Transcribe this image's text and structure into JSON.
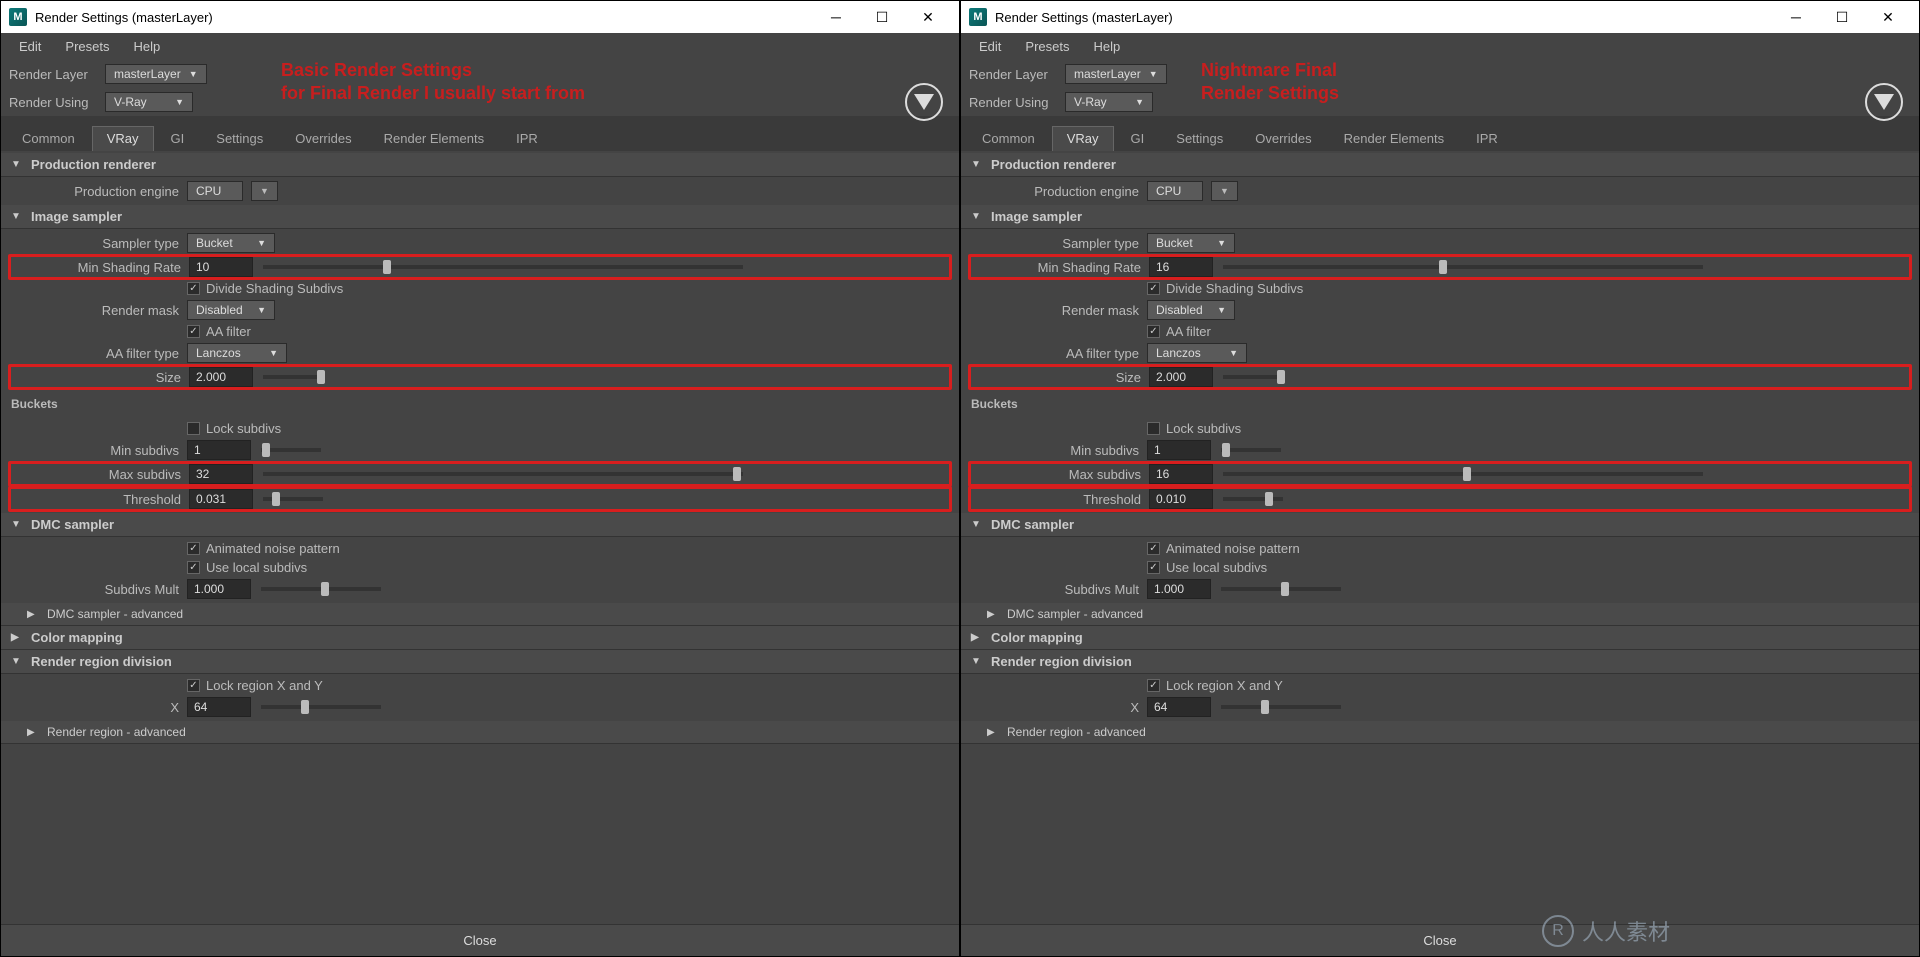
{
  "left": {
    "annotation": "Basic Render Settings\nfor Final Render I usually start from",
    "title": "Render Settings (masterLayer)",
    "menu": [
      "Edit",
      "Presets",
      "Help"
    ],
    "render_layer_label": "Render Layer",
    "render_layer_value": "masterLayer",
    "render_using_label": "Render Using",
    "render_using_value": "V-Ray",
    "tabs": [
      "Common",
      "VRay",
      "GI",
      "Settings",
      "Overrides",
      "Render Elements",
      "IPR"
    ],
    "active_tab": "VRay",
    "sections": {
      "production_renderer": "Production renderer",
      "image_sampler": "Image sampler",
      "buckets": "Buckets",
      "dmc_sampler": "DMC sampler",
      "dmc_advanced": "DMC sampler - advanced",
      "color_mapping": "Color mapping",
      "render_region": "Render region division",
      "render_region_adv": "Render region - advanced"
    },
    "fields": {
      "production_engine_label": "Production engine",
      "production_engine_value": "CPU",
      "sampler_type_label": "Sampler type",
      "sampler_type_value": "Bucket",
      "min_shading_rate_label": "Min Shading Rate",
      "min_shading_rate_value": "10",
      "divide_shading": "Divide Shading Subdivs",
      "render_mask_label": "Render mask",
      "render_mask_value": "Disabled",
      "aa_filter": "AA filter",
      "aa_filter_type_label": "AA filter type",
      "aa_filter_type_value": "Lanczos",
      "size_label": "Size",
      "size_value": "2.000",
      "lock_subdivs": "Lock subdivs",
      "min_subdivs_label": "Min subdivs",
      "min_subdivs_value": "1",
      "max_subdivs_label": "Max subdivs",
      "max_subdivs_value": "32",
      "threshold_label": "Threshold",
      "threshold_value": "0.031",
      "animated_noise": "Animated noise pattern",
      "use_local_subdivs": "Use local subdivs",
      "subdivs_mult_label": "Subdivs Mult",
      "subdivs_mult_value": "1.000",
      "lock_region": "Lock region X and Y",
      "x_label": "X",
      "x_value": "64"
    },
    "close": "Close"
  },
  "right": {
    "annotation": "Nightmare Final\nRender Settings",
    "title": "Render Settings (masterLayer)",
    "menu": [
      "Edit",
      "Presets",
      "Help"
    ],
    "render_layer_label": "Render Layer",
    "render_layer_value": "masterLayer",
    "render_using_label": "Render Using",
    "render_using_value": "V-Ray",
    "tabs": [
      "Common",
      "VRay",
      "GI",
      "Settings",
      "Overrides",
      "Render Elements",
      "IPR"
    ],
    "active_tab": "VRay",
    "sections": {
      "production_renderer": "Production renderer",
      "image_sampler": "Image sampler",
      "buckets": "Buckets",
      "dmc_sampler": "DMC sampler",
      "dmc_advanced": "DMC sampler - advanced",
      "color_mapping": "Color mapping",
      "render_region": "Render region division",
      "render_region_adv": "Render region - advanced"
    },
    "fields": {
      "production_engine_label": "Production engine",
      "production_engine_value": "CPU",
      "sampler_type_label": "Sampler type",
      "sampler_type_value": "Bucket",
      "min_shading_rate_label": "Min Shading Rate",
      "min_shading_rate_value": "16",
      "divide_shading": "Divide Shading Subdivs",
      "render_mask_label": "Render mask",
      "render_mask_value": "Disabled",
      "aa_filter": "AA filter",
      "aa_filter_type_label": "AA filter type",
      "aa_filter_type_value": "Lanczos",
      "size_label": "Size",
      "size_value": "2.000",
      "lock_subdivs": "Lock subdivs",
      "min_subdivs_label": "Min subdivs",
      "min_subdivs_value": "1",
      "max_subdivs_label": "Max subdivs",
      "max_subdivs_value": "16",
      "threshold_label": "Threshold",
      "threshold_value": "0.010",
      "animated_noise": "Animated noise pattern",
      "use_local_subdivs": "Use local subdivs",
      "subdivs_mult_label": "Subdivs Mult",
      "subdivs_mult_value": "1.000",
      "lock_region": "Lock region X and Y",
      "x_label": "X",
      "x_value": "64"
    },
    "close": "Close"
  },
  "watermark": "人人素材",
  "app_icon_letter": "M"
}
